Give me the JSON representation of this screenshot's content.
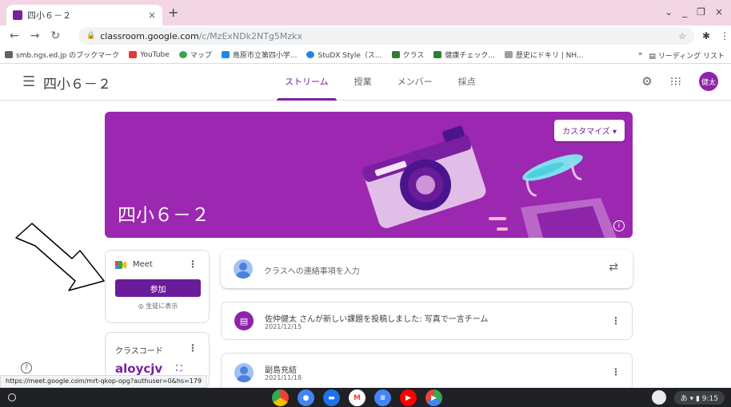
{
  "browser": {
    "tab_title": "四小６－２",
    "tab_close": "×",
    "new_tab": "+",
    "window_controls": [
      "⌄",
      "_",
      "❐",
      "×"
    ],
    "url_host": "classroom.google.com",
    "url_path": "/c/MzExNDk2NTg5Mzkx",
    "bookmarks": [
      {
        "label": "smb.ngs.ed.jp のブックマーク",
        "color": "#5f6368"
      },
      {
        "label": "YouTube",
        "color": "#e53935"
      },
      {
        "label": "マップ",
        "color": "#34a853"
      },
      {
        "label": "島原市立第四小学...",
        "color": "#1e88e5"
      },
      {
        "label": "StuDX Style（ス...",
        "color": "#1e88e5"
      },
      {
        "label": "クラス",
        "color": "#2e7d32"
      },
      {
        "label": "健康チェック...",
        "color": "#2e7d32"
      },
      {
        "label": "歴史にドキリ | NH...",
        "color": "#9e9e9e"
      }
    ],
    "reading_list": "リーディング リスト"
  },
  "app": {
    "class_title": "四小６－２",
    "tabs": [
      "ストリーム",
      "授業",
      "メンバー",
      "採点"
    ],
    "avatar_text": "健太"
  },
  "banner": {
    "title": "四小６－２",
    "customize_label": "カスタマイズ ▾",
    "color": "#9c27b0"
  },
  "meet": {
    "label": "Meet",
    "join_label": "参加",
    "visible_label": "◎ 生徒に表示"
  },
  "class_code": {
    "label": "クラスコード",
    "code": "aloycjv"
  },
  "stream": {
    "announce_placeholder": "クラスへの連絡事項を入力",
    "posts": [
      {
        "title": "佐仲健太 さんが新しい課題を投稿しました: 写真で一言チーム",
        "date": "2021/12/15"
      },
      {
        "title": "副島充結",
        "date": "2021/11/18"
      }
    ]
  },
  "status_url": "https://meet.google.com/mrt-qkop-opg?authuser=0&hs=179",
  "shelf": {
    "time": "9:15",
    "ime": "あ"
  }
}
